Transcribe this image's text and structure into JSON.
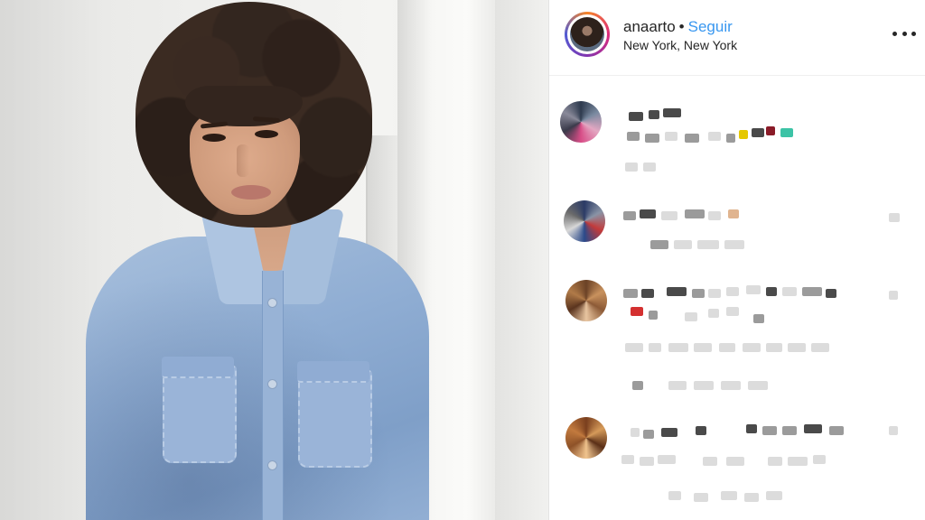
{
  "post": {
    "header": {
      "username": "anaarto",
      "separator": "•",
      "follow_label": "Seguir",
      "location": "New York, New York",
      "more_icon": "more-horizontal-icon"
    },
    "colors": {
      "follow_blue": "#3897f0",
      "text_dark": "#262626",
      "story_ring": [
        "#f58529",
        "#dd2a7b",
        "#8134af",
        "#515bd4"
      ]
    },
    "comments": [
      {
        "avatar": "pixelated-avatar",
        "text_visible": false
      },
      {
        "avatar": "pixelated-avatar",
        "text_visible": false
      },
      {
        "avatar": "pixelated-avatar",
        "text_visible": false
      },
      {
        "avatar": "pixelated-avatar",
        "text_visible": false
      }
    ]
  }
}
